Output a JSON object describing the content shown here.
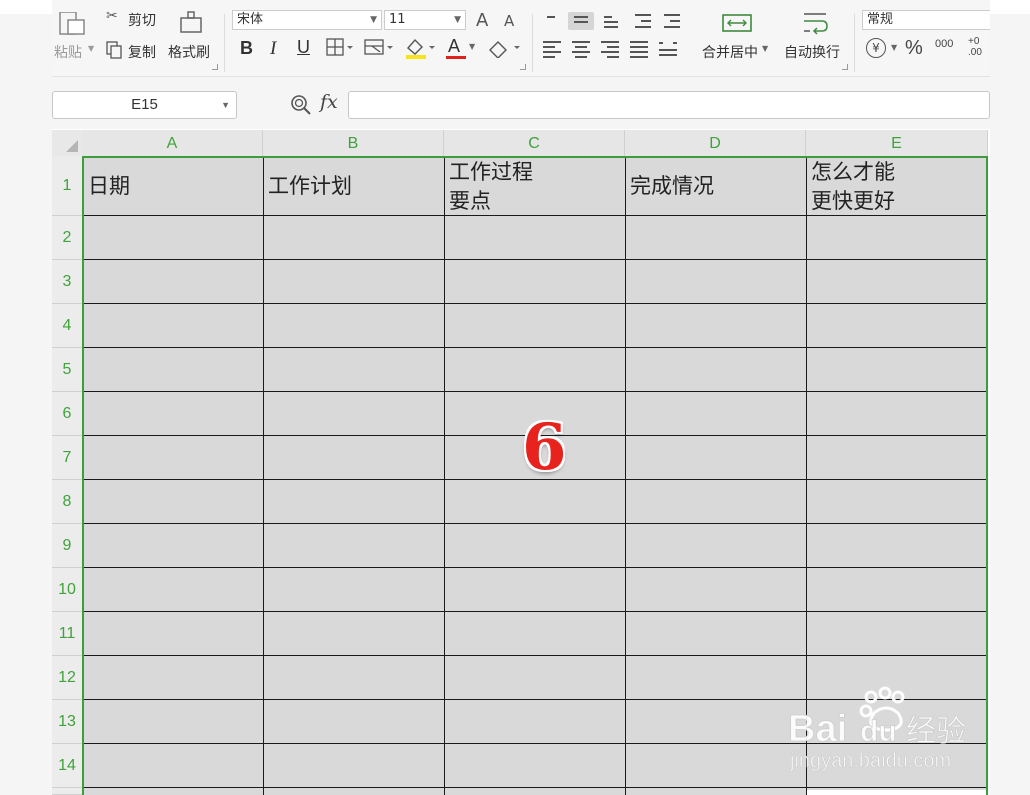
{
  "ribbon": {
    "paste_label": "粘贴",
    "cut_label": "剪切",
    "copy_label": "复制",
    "format_painter_label": "格式刷",
    "font_name": "宋体",
    "font_size": "11",
    "bold": "B",
    "italic": "I",
    "underline": "U",
    "font_color_glyph": "A",
    "merge_center_label": "合并居中",
    "wrap_text_label": "自动换行",
    "number_format": "常规",
    "currency_glyph": "¥",
    "percent_glyph": "%",
    "thousands_glyph": "000",
    "decimal_inc_glyph": "+0\n.00",
    "font_grow_glyph": "A",
    "font_shrink_glyph": "A"
  },
  "formula_bar": {
    "name_box": "E15",
    "fx_label": "fx",
    "formula": ""
  },
  "grid": {
    "columns": [
      "A",
      "B",
      "C",
      "D",
      "E"
    ],
    "rows": [
      "1",
      "2",
      "3",
      "4",
      "5",
      "6",
      "7",
      "8",
      "9",
      "10",
      "11",
      "12",
      "13",
      "14"
    ],
    "header_cells": {
      "A1": "日期",
      "B1": "工作计划",
      "C1_line1": "工作过程",
      "C1_line2": "要点",
      "D1": "完成情况",
      "E1_line1": "怎么才能",
      "E1_line2": "更快更好"
    },
    "header_color": "#3fa33a",
    "selection_color": "#3e9c3e",
    "fill_color": "#d9d9d9"
  },
  "overlay": {
    "step_number": "6",
    "step_color": "#e8231d"
  },
  "watermark": {
    "brand": "Bai du 经验",
    "url": "jingyan.baidu.com"
  }
}
